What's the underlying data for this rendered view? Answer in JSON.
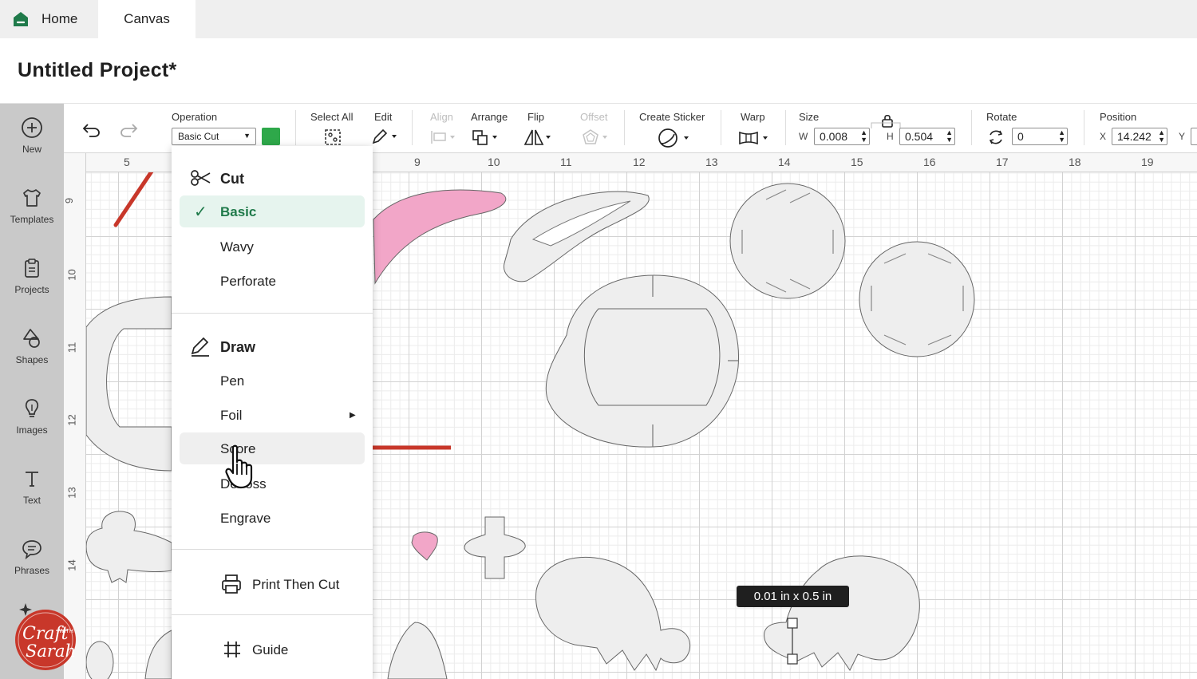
{
  "tabs": {
    "home": "Home",
    "canvas": "Canvas"
  },
  "project": {
    "title": "Untitled Project*"
  },
  "sidebar": {
    "items": [
      {
        "label": "New",
        "icon": "plus-circle-icon"
      },
      {
        "label": "Templates",
        "icon": "shirt-icon"
      },
      {
        "label": "Projects",
        "icon": "clipboard-icon"
      },
      {
        "label": "Shapes",
        "icon": "shapes-icon"
      },
      {
        "label": "Images",
        "icon": "lightbulb-icon"
      },
      {
        "label": "Text",
        "icon": "text-icon"
      },
      {
        "label": "Phrases",
        "icon": "speech-bubble-icon"
      }
    ]
  },
  "toolbar": {
    "operation_label": "Operation",
    "operation_value": "Basic Cut",
    "operation_color": "#2ea84a",
    "select_all": "Select All",
    "edit": "Edit",
    "align": "Align",
    "arrange": "Arrange",
    "flip": "Flip",
    "offset": "Offset",
    "create_sticker": "Create Sticker",
    "warp": "Warp",
    "size_label": "Size",
    "w_label": "W",
    "w_value": "0.008",
    "h_label": "H",
    "h_value": "0.504",
    "rotate_label": "Rotate",
    "rotate_value": "0",
    "position_label": "Position",
    "x_label": "X",
    "x_value": "14.242",
    "y_label": "Y"
  },
  "ruler": {
    "top": [
      "5",
      "9",
      "10",
      "11",
      "12",
      "13",
      "14",
      "15",
      "16",
      "17",
      "18",
      "19"
    ],
    "left": [
      "9",
      "10",
      "11",
      "12",
      "13",
      "14"
    ]
  },
  "menu": {
    "cut_header": "Cut",
    "basic": "Basic",
    "wavy": "Wavy",
    "perforate": "Perforate",
    "draw_header": "Draw",
    "pen": "Pen",
    "foil": "Foil",
    "score": "Score",
    "deboss": "Deboss",
    "engrave": "Engrave",
    "print_then_cut": "Print Then Cut",
    "guide": "Guide"
  },
  "size_tooltip": "0.01  in x 0.5  in",
  "brand": {
    "line1": "Craft",
    "line2": "Sarah",
    "with": "WITH"
  },
  "colors": {
    "accent_green": "#2ea84a",
    "annotation_red": "#c8372a",
    "shape_pink": "#f2a6c8",
    "shape_gray": "#eeeeee"
  }
}
